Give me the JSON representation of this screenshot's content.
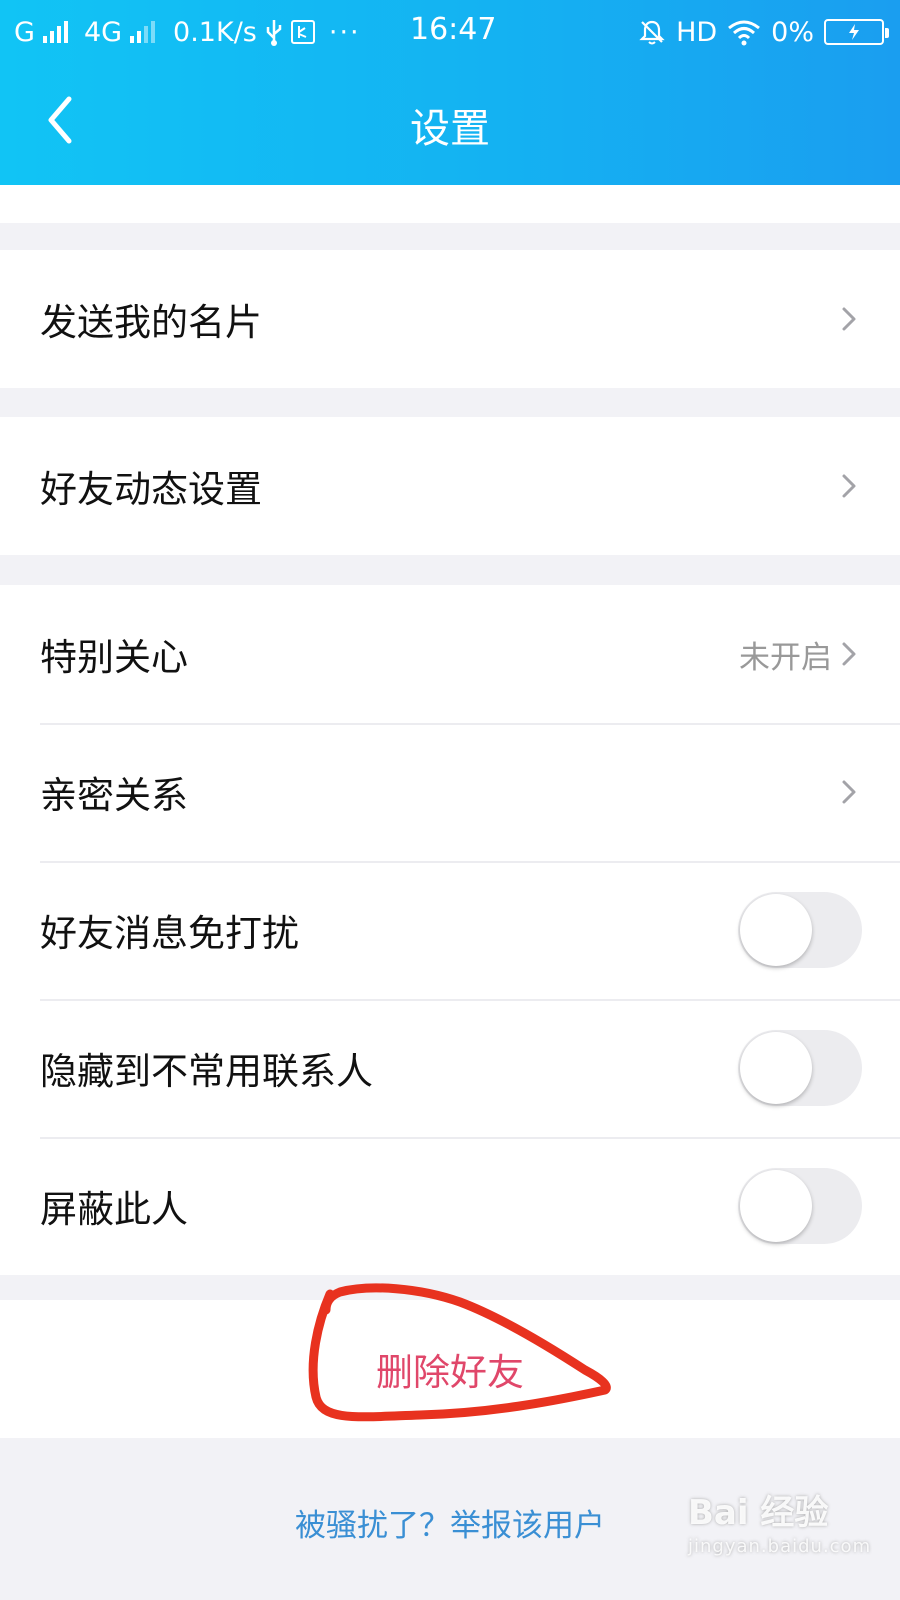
{
  "status_bar": {
    "carrier1": "G",
    "carrier2": "4G",
    "net_speed": "0.1K/s",
    "usb_box": "USB",
    "more": "···",
    "time": "16:47",
    "hd": "HD",
    "battery_percent": "0%"
  },
  "header": {
    "title": "设置"
  },
  "groups": {
    "card": {
      "label": "发送我的名片"
    },
    "feed": {
      "label": "好友动态设置"
    },
    "special_care": {
      "label": "特别关心",
      "value": "未开启"
    },
    "intimacy": {
      "label": "亲密关系"
    },
    "mute": {
      "label": "好友消息免打扰",
      "enabled": false
    },
    "hide": {
      "label": "隐藏到不常用联系人",
      "enabled": false
    },
    "block": {
      "label": "屏蔽此人",
      "enabled": false
    }
  },
  "actions": {
    "delete_friend": "删除好友",
    "report": "被骚扰了？举报该用户"
  },
  "watermark": {
    "brand": "Bai 经验",
    "url": "jingyan.baidu.com"
  },
  "colors": {
    "header_start": "#11c4f5",
    "header_end": "#1a9ef0",
    "delete": "#e0476a",
    "link": "#3a8fd4",
    "annotation": "#e8321f"
  }
}
